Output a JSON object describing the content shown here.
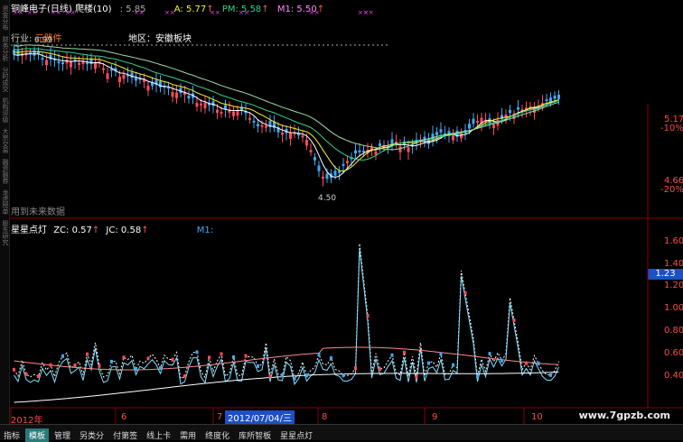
{
  "header": {
    "title": "铜峰电子(日线)",
    "indicator": "爬楼(10)",
    "val1_label": ":",
    "val1": "5.85",
    "a_label": "A:",
    "a_val": "5.77",
    "pm_label": "PM:",
    "pm_val": "5.58",
    "m1_label": "M1:",
    "m1_val": "5.50",
    "industry": "行业:",
    "industry_val": "元器件",
    "region": "地区：安徽板块",
    "peak_label": "6.99",
    "low_label": "4.50",
    "future_data": "用到未来数据"
  },
  "main_axis": {
    "labels": [
      {
        "price": "5.17",
        "pct": "-10%"
      },
      {
        "price": "4.66",
        "pct": "-20%"
      }
    ]
  },
  "sub_panel": {
    "title": "星星点灯",
    "zc_label": "ZC:",
    "zc_val": "0.57",
    "jc_label": "JC:",
    "jc_val": "0.58",
    "m1_label": "M1:",
    "axis": [
      "1.60",
      "1.40",
      "1.20",
      "1.00",
      "0.80",
      "0.60",
      "0.40"
    ],
    "current": "1.23"
  },
  "x_axis": {
    "labels": [
      "2012年",
      "6",
      "7",
      "2012/07/04/三",
      "8",
      "9",
      "10"
    ]
  },
  "tabs": [
    {
      "label": "指标",
      "active": false
    },
    {
      "label": "模板",
      "active": true
    },
    {
      "label": "管理",
      "active": false
    },
    {
      "label": "另类分",
      "active": false
    },
    {
      "label": "付第签",
      "active": false
    },
    {
      "label": "线上卡",
      "active": false
    },
    {
      "label": "需用",
      "active": false
    },
    {
      "label": "终度化",
      "active": false
    },
    {
      "label": "库所智板",
      "active": false
    },
    {
      "label": "星星点灯",
      "active": false
    }
  ],
  "left_strip": [
    "资金分布",
    "财务分析",
    "分时成交",
    "机构评级",
    "大宗交易",
    "融资融券",
    "龙虎榜单",
    "股东研究"
  ],
  "watermark": "www.7gpzb.com",
  "colors": {
    "up": "#ff4b5c",
    "down": "#3fa9f5",
    "ma1": "#ffffff",
    "ma2": "#f5f530",
    "ma3": "#34d28a",
    "ma4": "#ff8cff",
    "grid": "#7a0000"
  }
}
